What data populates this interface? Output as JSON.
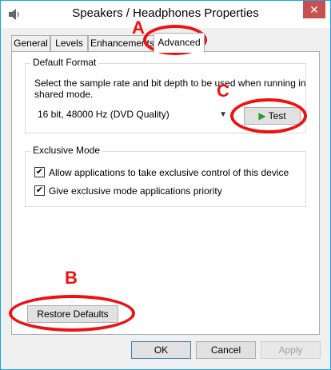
{
  "window": {
    "title": "Speakers / Headphones Properties",
    "close_glyph": "✕"
  },
  "tabs": [
    {
      "label": "General"
    },
    {
      "label": "Levels"
    },
    {
      "label": "Enhancements"
    },
    {
      "label": "Advanced",
      "active": true
    }
  ],
  "default_format": {
    "legend": "Default Format",
    "description": "Select the sample rate and bit depth to be used when running in shared mode.",
    "selected": "16 bit, 48000 Hz (DVD Quality)",
    "test_label": "Test"
  },
  "exclusive_mode": {
    "legend": "Exclusive Mode",
    "options": [
      {
        "label": "Allow applications to take exclusive control of this device",
        "checked": true
      },
      {
        "label": "Give exclusive mode applications priority",
        "checked": true
      }
    ]
  },
  "restore_defaults_label": "Restore Defaults",
  "footer": {
    "ok": "OK",
    "cancel": "Cancel",
    "apply": "Apply"
  },
  "annotations": {
    "a": "A",
    "b": "B",
    "c": "C"
  },
  "colors": {
    "accent": "#1aa3e8",
    "close_button": "#c74f4f",
    "annotation": "#ee1111",
    "play_icon": "#2d9b2d"
  },
  "icons": {
    "app": "speaker-icon",
    "play": "play-icon",
    "dropdown": "chevron-down-icon",
    "check": "checkmark-icon"
  }
}
